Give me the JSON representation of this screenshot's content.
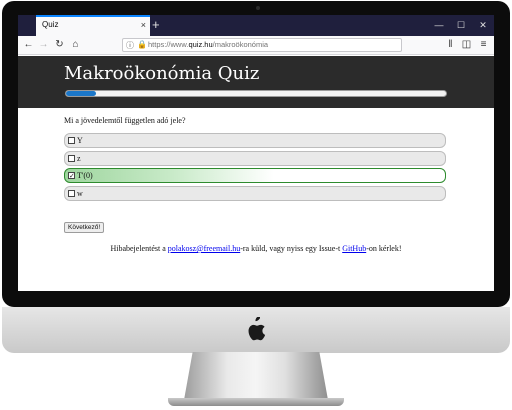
{
  "browser": {
    "tab_title": "Quiz",
    "tab_close": "×",
    "new_tab": "+",
    "url_protocol": "https://www.",
    "url_domain": "quiz.hu",
    "url_path": "/makroökonómia"
  },
  "quiz": {
    "title": "Makroökonómia Quiz",
    "progress_fraction": 0.08,
    "question": "Mi a jövedelemtől független adó jele?",
    "answers": [
      {
        "label": "Y",
        "checked": false
      },
      {
        "label": "z",
        "checked": false
      },
      {
        "label": "T'(0)",
        "checked": true
      },
      {
        "label": "w",
        "checked": false
      }
    ],
    "next_button": "Következő!"
  },
  "footer": {
    "text_before": "Hibabejelentést a ",
    "email": "polakosz@freemail.hu",
    "text_middle": "-ra küld, vagy nyiss egy Issue-t ",
    "github": "GitHub",
    "text_after": "-on kérlek!"
  },
  "colors": {
    "header_bg": "#2b2b2b",
    "progress_fill": "#1b77c9",
    "selected_border": "#2e8b2e",
    "link": "#0000ee"
  }
}
